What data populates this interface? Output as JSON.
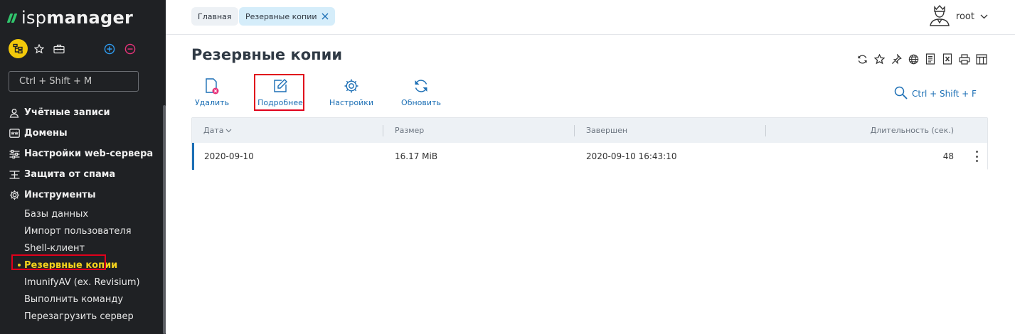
{
  "app": {
    "logo_text_light": "isp",
    "logo_text_bold": "manager"
  },
  "colors": {
    "sidebar_bg": "#1f2124",
    "accent_yellow": "#f5d31c",
    "link_blue": "#1c6fb5",
    "brand_green": "#31c46c",
    "highlight_red": "#e0001b"
  },
  "sidebar": {
    "search": {
      "placeholder": "Ctrl + Shift + M"
    },
    "icons": [
      "tree-icon",
      "star-icon",
      "briefcase-icon",
      "plus-circle-icon",
      "minus-circle-icon"
    ],
    "groups": [
      {
        "label": "Учётные записи",
        "icon": "user-icon"
      },
      {
        "label": "Домены",
        "icon": "www-icon"
      },
      {
        "label": "Настройки web-сервера",
        "icon": "sliders-icon"
      },
      {
        "label": "Защита от спама",
        "icon": "filter-icon"
      },
      {
        "label": "Инструменты",
        "icon": "gear-icon"
      }
    ],
    "tools_items": [
      {
        "label": "Базы данных"
      },
      {
        "label": "Импорт пользователя"
      },
      {
        "label": "Shell-клиент"
      },
      {
        "label": "Резервные копии",
        "active": true
      },
      {
        "label": "ImunifyAV (ex. Revisium)"
      },
      {
        "label": "Выполнить команду"
      },
      {
        "label": "Перезагрузить сервер"
      }
    ]
  },
  "breadcrumbs": [
    {
      "label": "Главная"
    },
    {
      "label": "Резервные копии"
    }
  ],
  "user": {
    "name": "root"
  },
  "page": {
    "title": "Резервные копии"
  },
  "toolbar": {
    "delete_label": "Удалить",
    "details_label": "Подробнее",
    "settings_label": "Настройки",
    "refresh_label": "Обновить"
  },
  "header_tools": [
    "refresh-icon",
    "star-icon",
    "pin-icon",
    "globe-icon",
    "document-icon",
    "excel-icon",
    "print-icon",
    "columns-icon"
  ],
  "table_search": {
    "label": "Ctrl + Shift + F"
  },
  "table": {
    "columns": [
      {
        "label": "Дата"
      },
      {
        "label": "Размер"
      },
      {
        "label": "Завершен"
      },
      {
        "label": "Длительность (сек.)"
      }
    ],
    "rows": [
      {
        "date": "2020-09-10",
        "size": "16.17 MiB",
        "finished": "2020-09-10 16:43:10",
        "duration": "48"
      }
    ]
  }
}
